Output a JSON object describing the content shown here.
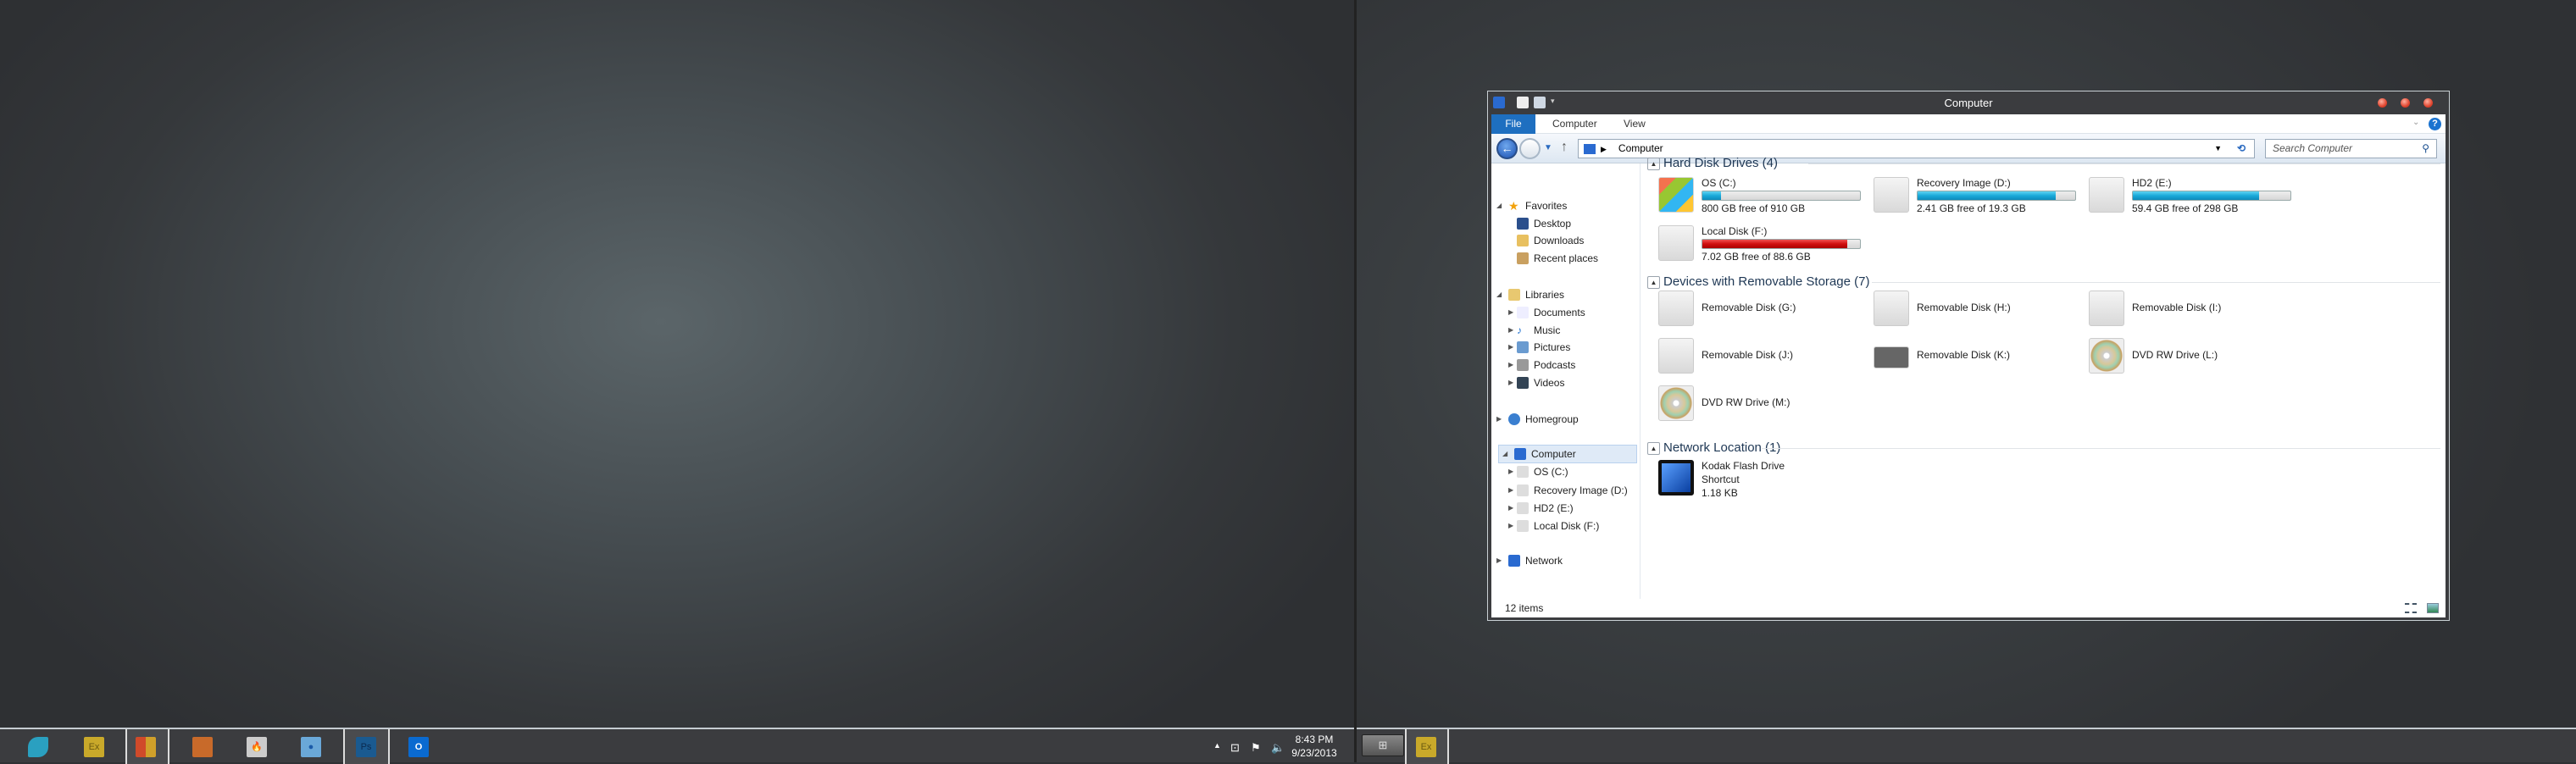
{
  "window": {
    "title": "Computer",
    "ribbon_tabs": [
      "File",
      "Computer",
      "View"
    ],
    "address": {
      "path": "Computer"
    },
    "search": {
      "placeholder": "Search Computer"
    },
    "nav": {
      "favorites": {
        "label": "Favorites",
        "items": [
          "Desktop",
          "Downloads",
          "Recent places"
        ]
      },
      "libraries": {
        "label": "Libraries",
        "items": [
          "Documents",
          "Music",
          "Pictures",
          "Podcasts",
          "Videos"
        ]
      },
      "homegroup": {
        "label": "Homegroup"
      },
      "computer": {
        "label": "Computer",
        "selected": true,
        "items": [
          "OS (C:)",
          "Recovery Image (D:)",
          "HD2 (E:)",
          "Local Disk (F:)"
        ]
      },
      "network": {
        "label": "Network"
      }
    },
    "sections": {
      "hdd": {
        "title": "Hard Disk Drives (4)",
        "items": [
          {
            "name": "OS (C:)",
            "free": "800 GB free of 910 GB",
            "used_fraction": 0.12,
            "color": "#19a9d9"
          },
          {
            "name": "Recovery Image (D:)",
            "free": "2.41 GB free of 19.3 GB",
            "used_fraction": 0.875,
            "color": "#19a9d9"
          },
          {
            "name": "HD2 (E:)",
            "free": "59.4 GB free of 298 GB",
            "used_fraction": 0.8,
            "color": "#19a9d9"
          },
          {
            "name": "Local Disk (F:)",
            "free": "7.02 GB free of 88.6 GB",
            "used_fraction": 0.92,
            "color": "#d01010"
          }
        ]
      },
      "removable": {
        "title": "Devices with Removable Storage (7)",
        "items": [
          "Removable Disk (G:)",
          "Removable Disk (H:)",
          "Removable Disk (I:)",
          "Removable Disk (J:)",
          "Removable Disk (K:)",
          "DVD RW Drive (L:)",
          "DVD RW Drive (M:)"
        ]
      },
      "network": {
        "title": "Network Location (1)",
        "items": [
          {
            "name": "Kodak Flash Drive",
            "name2": "Shortcut",
            "size": "1.18 KB"
          }
        ]
      }
    },
    "status": {
      "count": "12 items"
    }
  },
  "taskbar": {
    "left_apps": [
      "internet-explorer",
      "expression-web",
      "windows-store",
      "media-player",
      "burn-app",
      "water-app",
      "photoshop",
      "outlook"
    ],
    "photoshop_label": "Ps",
    "expression_label": "Ex",
    "outlook_label": "O",
    "clock": {
      "time": "8:43 PM",
      "date": "9/23/2013"
    },
    "right_apps": [
      "start",
      "expression-web"
    ]
  }
}
